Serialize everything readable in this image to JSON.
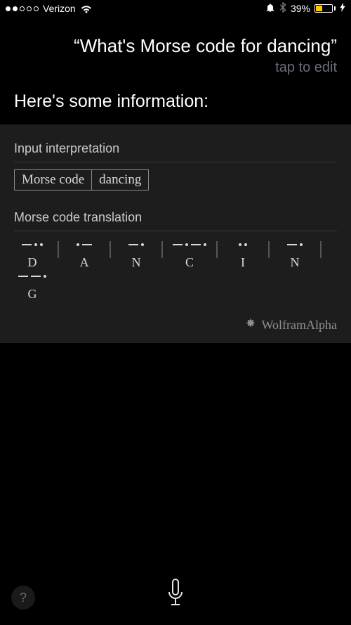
{
  "status": {
    "signal_dots_filled": 2,
    "signal_dots_total": 5,
    "carrier": "Verizon",
    "battery_percent": "39%"
  },
  "query": {
    "text": "What's Morse code for dancing",
    "open_quote": "“",
    "close_quote": "”",
    "tap_to_edit": "tap to edit"
  },
  "response": {
    "heading": "Here's some information:"
  },
  "wolfram": {
    "input_interpretation_label": "Input interpretation",
    "input_cells": [
      "Morse code",
      "dancing"
    ],
    "translation_label": "Morse code translation",
    "letters": [
      {
        "letter": "D",
        "pattern": [
          "dash",
          "dot",
          "dot"
        ]
      },
      {
        "letter": "A",
        "pattern": [
          "dot",
          "dash"
        ]
      },
      {
        "letter": "N",
        "pattern": [
          "dash",
          "dot"
        ]
      },
      {
        "letter": "C",
        "pattern": [
          "dash",
          "dot",
          "dash",
          "dot"
        ]
      },
      {
        "letter": "I",
        "pattern": [
          "dot",
          "dot"
        ]
      },
      {
        "letter": "N",
        "pattern": [
          "dash",
          "dot"
        ]
      },
      {
        "letter": "G",
        "pattern": [
          "dash",
          "dash",
          "dot"
        ]
      }
    ],
    "brand": "WolframAlpha"
  },
  "bottom": {
    "help_label": "?"
  }
}
